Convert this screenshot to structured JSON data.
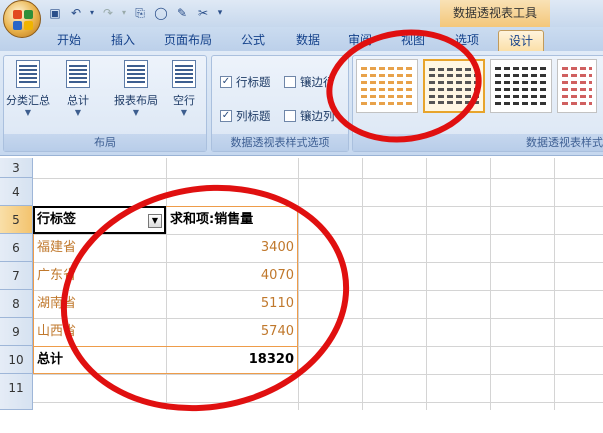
{
  "window": {
    "contextual_tab": "数据透视表工具"
  },
  "tabs": [
    {
      "label": "开始"
    },
    {
      "label": "插入"
    },
    {
      "label": "页面布局"
    },
    {
      "label": "公式"
    },
    {
      "label": "数据"
    },
    {
      "label": "审阅"
    },
    {
      "label": "视图"
    },
    {
      "label": "选项"
    },
    {
      "label": "设计"
    }
  ],
  "ribbon": {
    "layout_group": {
      "label": "布局",
      "buttons": [
        {
          "label": "分类汇总",
          "icon": "subtotals-icon"
        },
        {
          "label": "总计",
          "icon": "grand-totals-icon"
        },
        {
          "label": "报表布局",
          "icon": "report-layout-icon"
        },
        {
          "label": "空行",
          "icon": "blank-rows-icon"
        }
      ]
    },
    "style_options_group": {
      "label": "数据透视表样式选项",
      "row_headers": {
        "label": "行标题",
        "checked": true
      },
      "banded_rows": {
        "label": "镶边行",
        "checked": false
      },
      "column_headers": {
        "label": "列标题",
        "checked": true
      },
      "banded_columns": {
        "label": "镶边列",
        "checked": false
      }
    },
    "styles_group": {
      "label": "数据透视表样式"
    }
  },
  "sheet": {
    "row_numbers": [
      "3",
      "4",
      "5",
      "6",
      "7",
      "8",
      "9",
      "10",
      "11"
    ],
    "header_row": {
      "col_a": "行标签",
      "col_b": "求和项:销售量"
    },
    "rows": [
      {
        "label": "福建省",
        "value": "3400"
      },
      {
        "label": "广东省",
        "value": "4070"
      },
      {
        "label": "湖南省",
        "value": "5110"
      },
      {
        "label": "山西省",
        "value": "5740"
      }
    ],
    "total_row": {
      "label": "总计",
      "value": "18320"
    }
  },
  "colors": {
    "annotation_red": "#e01010",
    "pivot_border": "#ee9c4a",
    "pivot_text": "#c0782c"
  }
}
